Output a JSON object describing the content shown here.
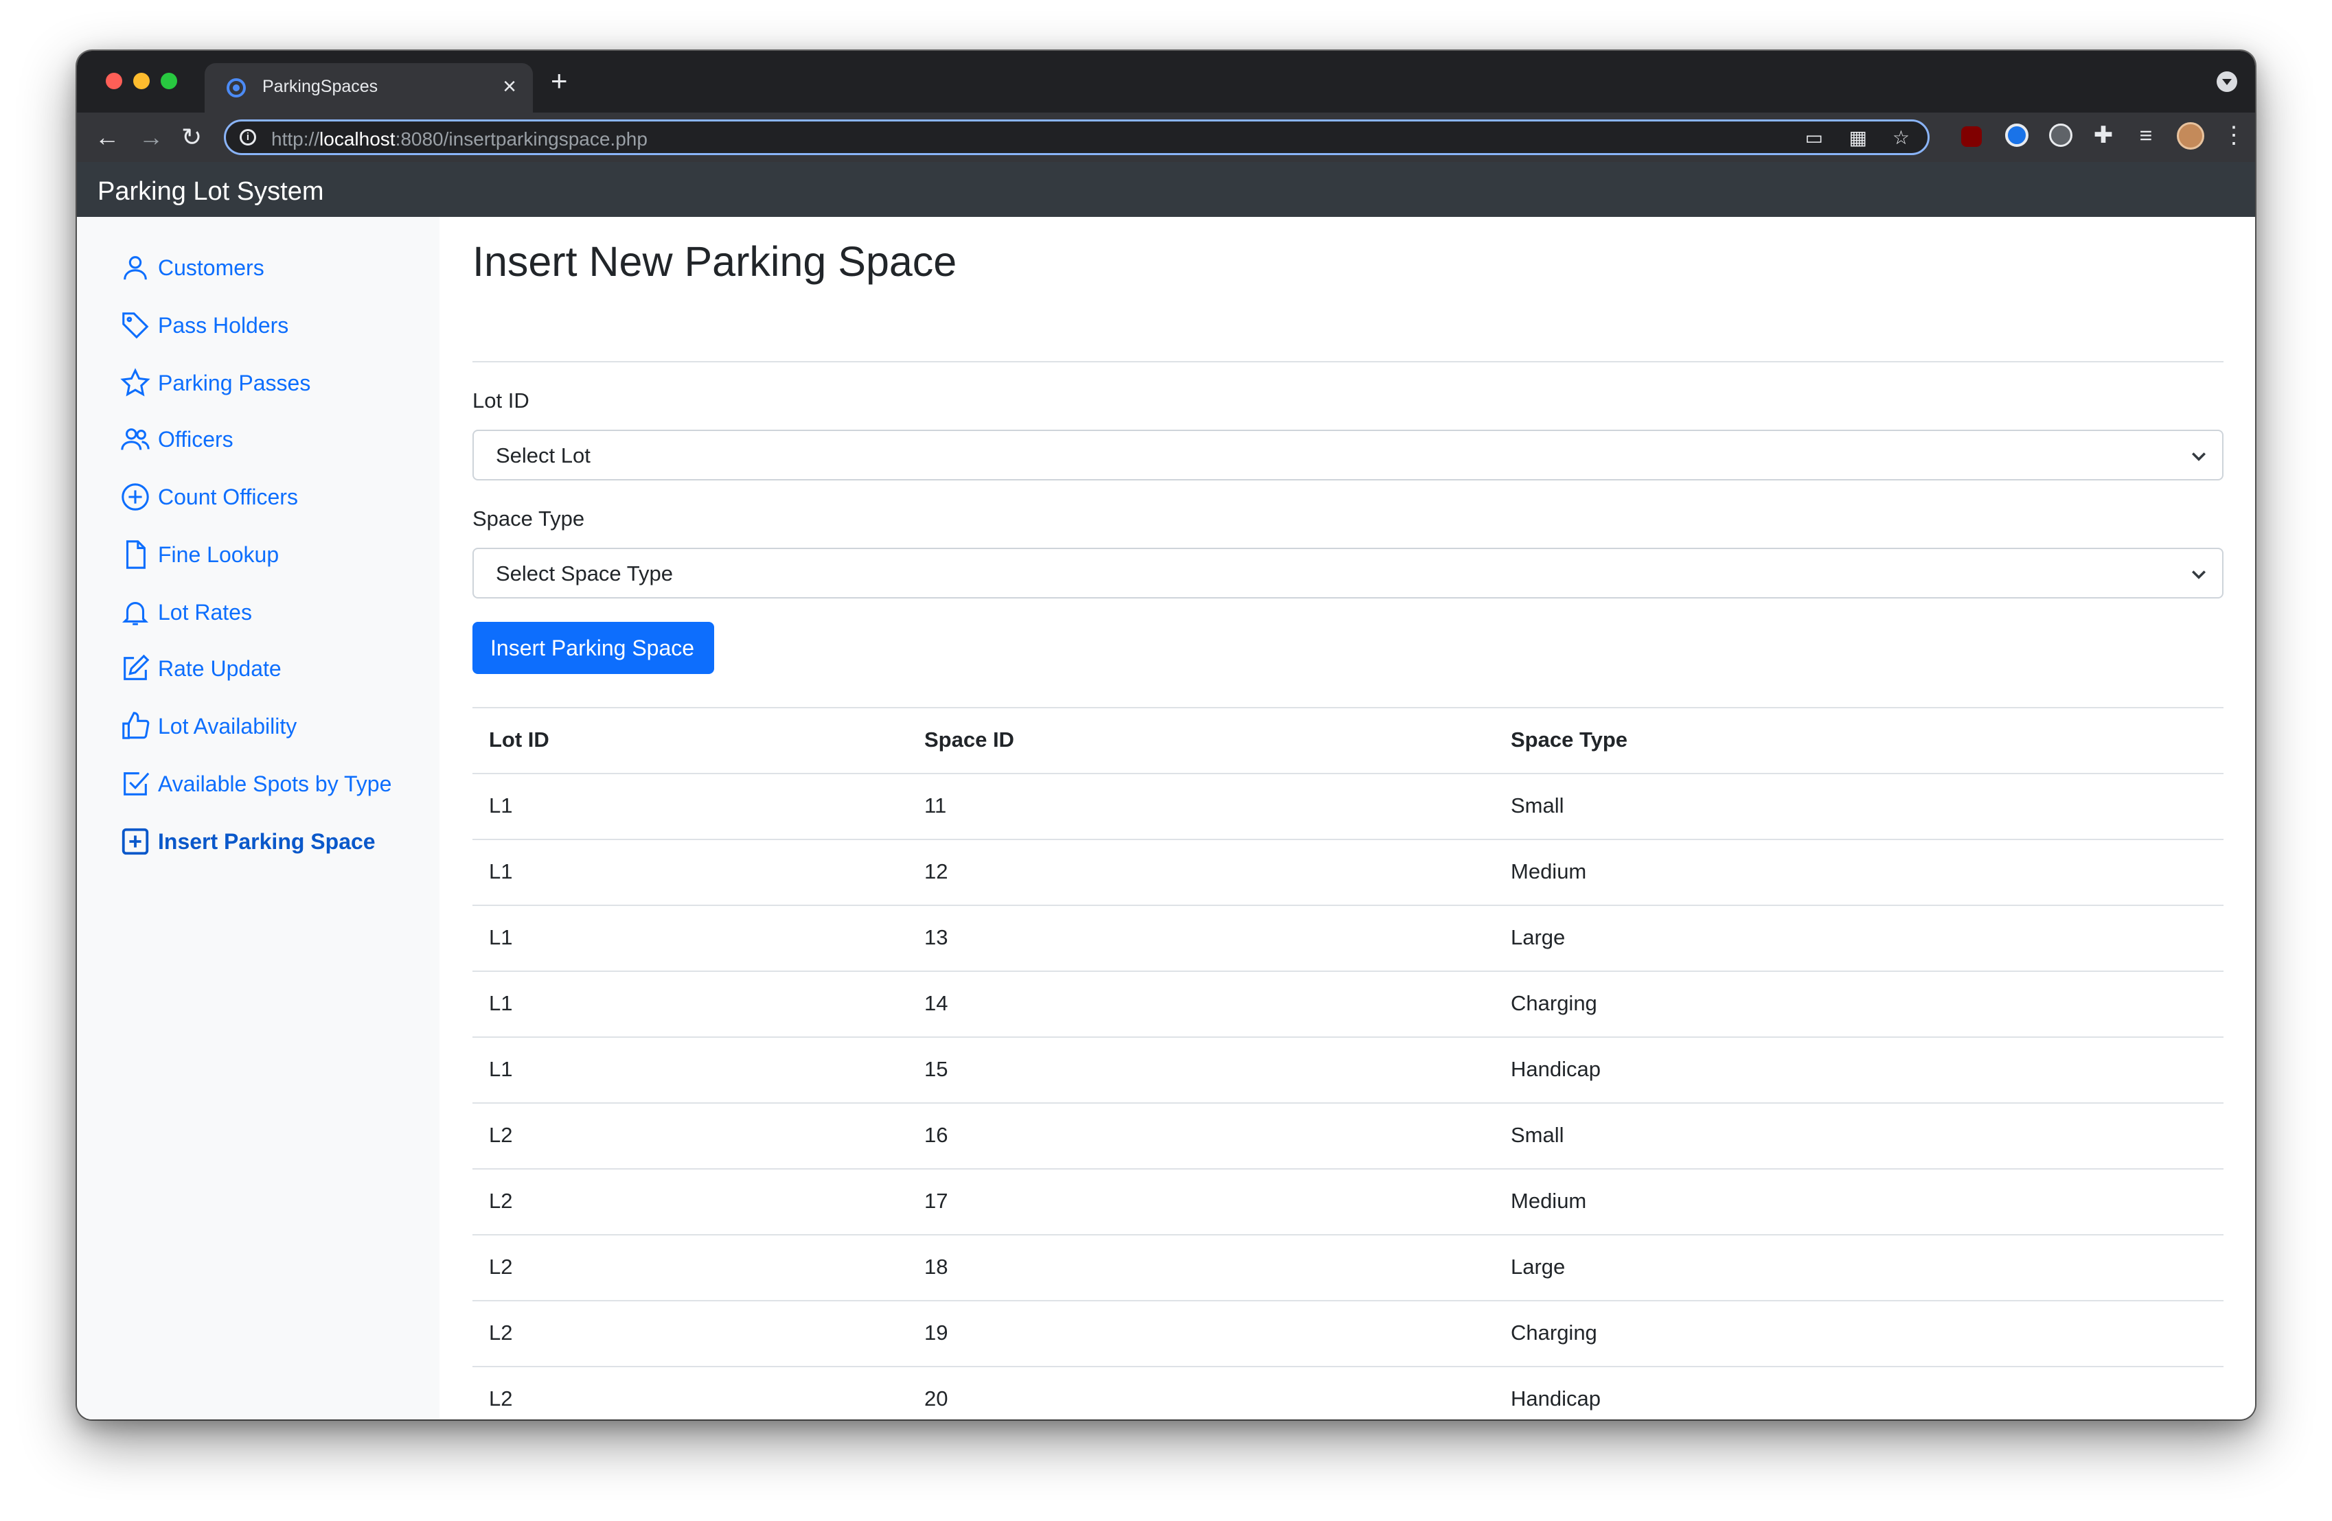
{
  "browser": {
    "tab_title": "ParkingSpaces",
    "tab_close": "×",
    "new_tab": "+",
    "url_scheme": "http://",
    "url_host": "localhost",
    "url_rest": ":8080/insertparkingspace.php"
  },
  "navbar": {
    "brand": "Parking Lot System"
  },
  "sidebar": {
    "items": [
      {
        "label": "Customers",
        "icon": "person-icon"
      },
      {
        "label": "Pass Holders",
        "icon": "tag-icon"
      },
      {
        "label": "Parking Passes",
        "icon": "star-icon"
      },
      {
        "label": "Officers",
        "icon": "people-icon"
      },
      {
        "label": "Count Officers",
        "icon": "plus-circle-icon"
      },
      {
        "label": "Fine Lookup",
        "icon": "file-icon"
      },
      {
        "label": "Lot Rates",
        "icon": "bell-icon"
      },
      {
        "label": "Rate Update",
        "icon": "edit-icon"
      },
      {
        "label": "Lot Availability",
        "icon": "thumbs-up-icon"
      },
      {
        "label": "Available Spots by Type",
        "icon": "check-square-icon"
      },
      {
        "label": "Insert Parking Space",
        "icon": "plus-square-icon",
        "active": true
      }
    ]
  },
  "main": {
    "title": "Insert New Parking Space",
    "form": {
      "lot_label": "Lot ID",
      "lot_value": "Select Lot",
      "space_type_label": "Space Type",
      "space_type_value": "Select Space Type",
      "submit_label": "Insert Parking Space"
    },
    "table": {
      "headers": [
        "Lot ID",
        "Space ID",
        "Space Type"
      ],
      "rows": [
        [
          "L1",
          "11",
          "Small"
        ],
        [
          "L1",
          "12",
          "Medium"
        ],
        [
          "L1",
          "13",
          "Large"
        ],
        [
          "L1",
          "14",
          "Charging"
        ],
        [
          "L1",
          "15",
          "Handicap"
        ],
        [
          "L2",
          "16",
          "Small"
        ],
        [
          "L2",
          "17",
          "Medium"
        ],
        [
          "L2",
          "18",
          "Large"
        ],
        [
          "L2",
          "19",
          "Charging"
        ],
        [
          "L2",
          "20",
          "Handicap"
        ]
      ]
    }
  },
  "colors": {
    "accent": "#0d6efd",
    "navbar": "#343a40",
    "sidebar_bg": "#f8f9fa"
  }
}
